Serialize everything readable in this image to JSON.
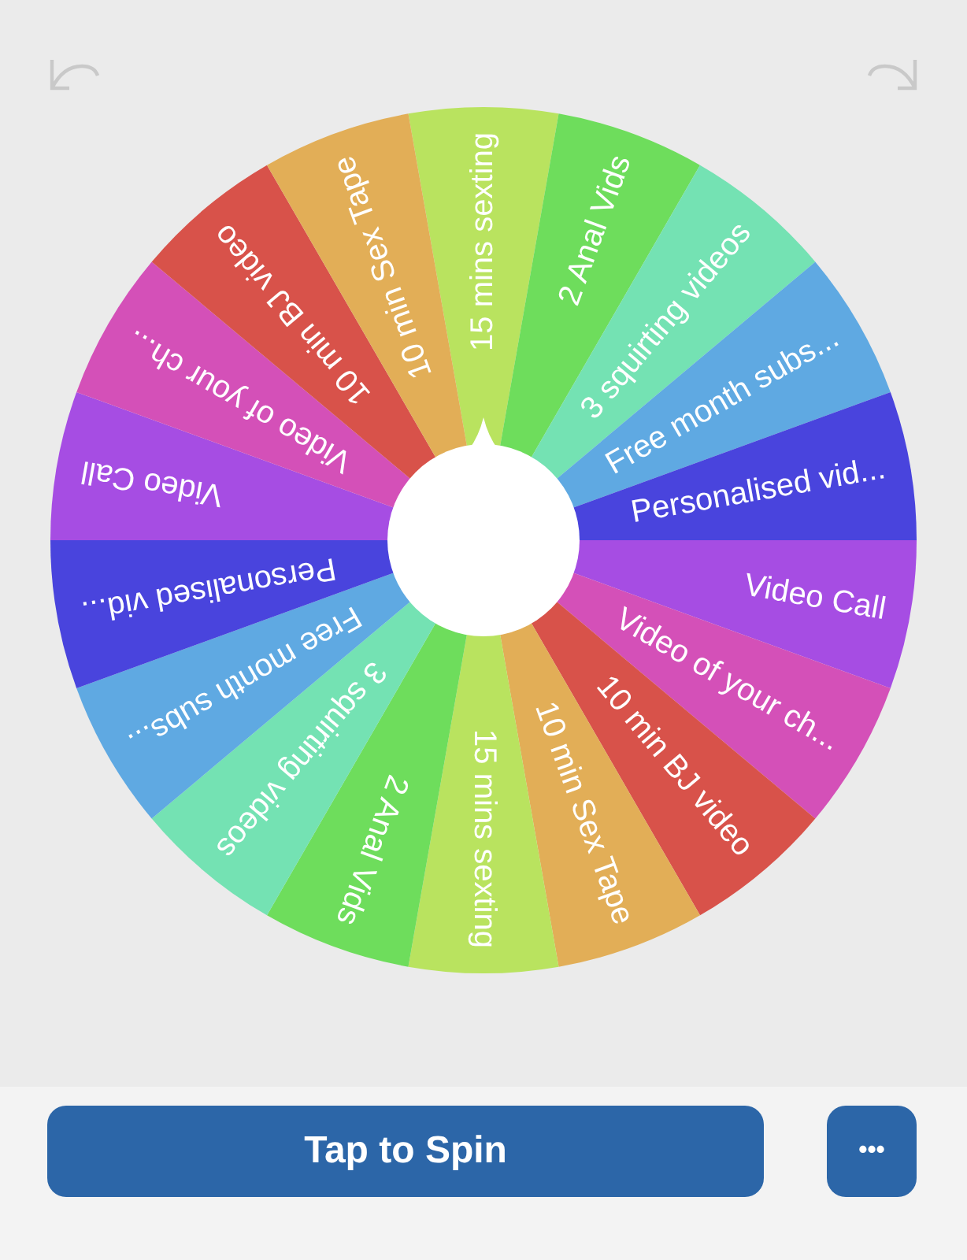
{
  "wheel": {
    "segments": [
      {
        "label": "15 mins sexting",
        "color": "#b9e35f"
      },
      {
        "label": "2 Anal Vids",
        "color": "#6edd5c"
      },
      {
        "label": "3 squirting videos",
        "color": "#74e2b3"
      },
      {
        "label": "Free month subs...",
        "color": "#5fa9e2"
      },
      {
        "label": "Personalised vid...",
        "color": "#4944dd"
      },
      {
        "label": "Video Call",
        "color": "#a64de3"
      },
      {
        "label": "Video of your ch...",
        "color": "#d450b8"
      },
      {
        "label": "10 min BJ video",
        "color": "#d8524a"
      },
      {
        "label": "10 min Sex Tape",
        "color": "#e2ae57"
      },
      {
        "label": "15 mins sexting",
        "color": "#b9e35f"
      },
      {
        "label": "2 Anal Vids",
        "color": "#6edd5c"
      },
      {
        "label": "3 squirting videos",
        "color": "#74e2b3"
      },
      {
        "label": "Free month subs...",
        "color": "#5fa9e2"
      },
      {
        "label": "Personalised vid...",
        "color": "#4944dd"
      },
      {
        "label": "Video Call",
        "color": "#a64de3"
      },
      {
        "label": "Video of your ch...",
        "color": "#d450b8"
      },
      {
        "label": "10 min BJ video",
        "color": "#d8524a"
      },
      {
        "label": "10 min Sex Tape",
        "color": "#e2ae57"
      }
    ]
  },
  "spin_button": "Tap to Spin",
  "more_button": "•••"
}
